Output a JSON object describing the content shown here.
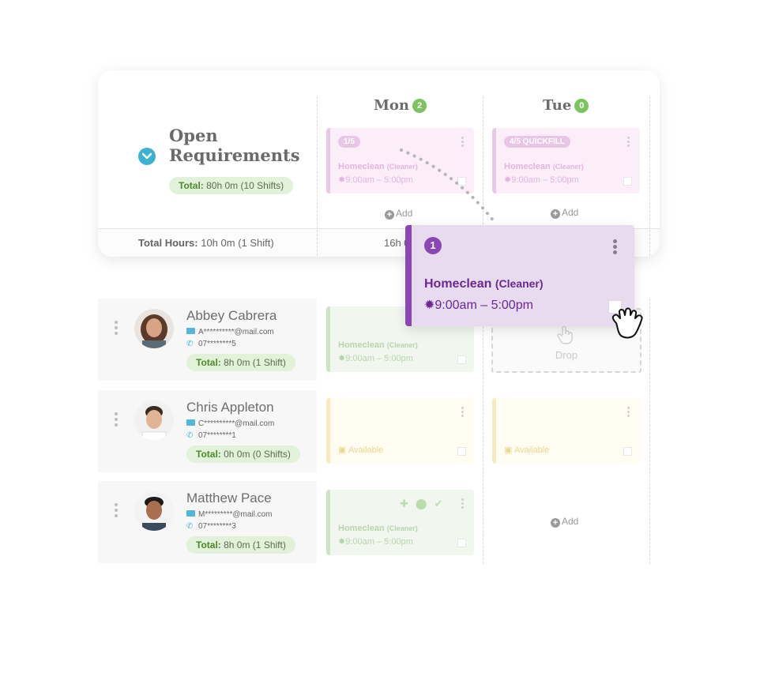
{
  "open_requirements": {
    "title": "Open Requirements",
    "total_label": "Total:",
    "total_value": "80h 0m (10 Shifts)"
  },
  "footer": {
    "total_label": "Total Hours:",
    "total_value": "10h 0m (1 Shift)",
    "mon_total": "16h 0"
  },
  "days": [
    {
      "name": "Mon",
      "count": "2"
    },
    {
      "name": "Tue",
      "count": "0"
    }
  ],
  "open_shifts": {
    "mon": {
      "tag": "1/5",
      "name": "Homeclean",
      "role": "(Cleaner)",
      "time": "9:00am – 5:00pm"
    },
    "tue": {
      "tag": "4/5 QUICKFILL",
      "name": "Homeclean",
      "role": "(Cleaner)",
      "time": "9:00am – 5:00pm"
    }
  },
  "add_label": "Add",
  "drop_label": "Drop",
  "available_label": "Available",
  "employees": [
    {
      "name": "Abbey Cabrera",
      "email": "A**********@mail.com",
      "phone": "07********5",
      "total_label": "Total:",
      "total_value": "8h 0m (1 Shift)",
      "mon_shift": {
        "name": "Homeclean",
        "role": "(Cleaner)",
        "time": "9:00am – 5:00pm"
      }
    },
    {
      "name": "Chris Appleton",
      "email": "C**********@mail.com",
      "phone": "07********1",
      "total_label": "Total:",
      "total_value": "0h 0m (0 Shifts)"
    },
    {
      "name": "Matthew Pace",
      "email": "M*********@mail.com",
      "phone": "07********3",
      "total_label": "Total:",
      "total_value": "8h 0m (1 Shift)",
      "mon_shift": {
        "name": "Homeclean",
        "role": "(Cleaner)",
        "time": "9:00am – 5:00pm"
      }
    }
  ],
  "drag_card": {
    "number": "1",
    "name": "Homeclean",
    "role": "(Cleaner)",
    "time": "9:00am – 5:00pm"
  },
  "colors": {
    "accent_purple": "#8a46b5",
    "badge_green": "#7cc45f",
    "chevron_blue": "#3bb2cf"
  }
}
